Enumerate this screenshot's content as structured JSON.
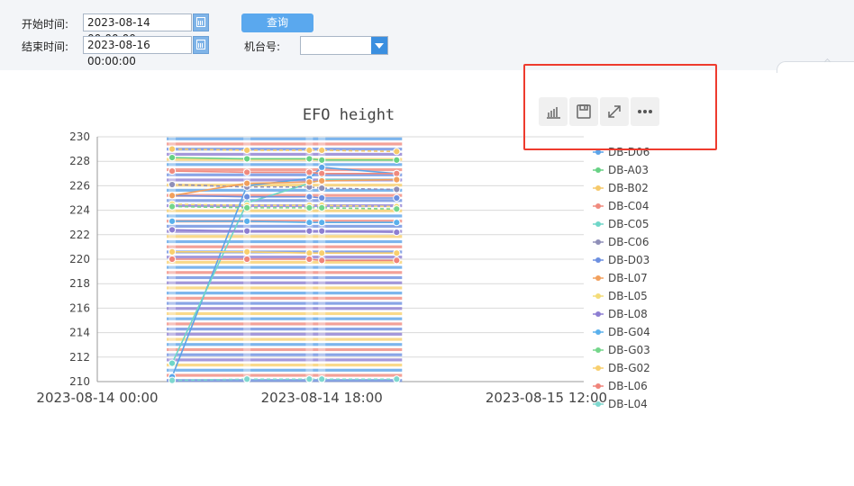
{
  "filters": {
    "start_label": "开始时间:",
    "start_value": "2023-08-14 00:00:00",
    "end_label": "结束时间:",
    "end_value": "2023-08-16 00:00:00",
    "machine_label": "机台号:",
    "machine_value": "",
    "query_button": "查询"
  },
  "toolbox": {
    "icons": [
      "bar-chart-icon",
      "save-icon",
      "expand-icon",
      "more-icon"
    ],
    "highlight_color": "#ee3b2e"
  },
  "chart_data": {
    "type": "line",
    "title": "EFO height",
    "xlabel": "",
    "ylabel": "",
    "x_ticks": [
      "2023-08-14 00:00",
      "2023-08-14 18:00",
      "2023-08-15 12:00"
    ],
    "y_ticks": [
      210,
      212,
      214,
      216,
      218,
      220,
      222,
      224,
      226,
      228,
      230
    ],
    "ylim": [
      210,
      230
    ],
    "xlim": [
      "2023-08-14 00:00",
      "2023-08-15 15:00"
    ],
    "grid": true,
    "legend_position": "right",
    "x": [
      "2023-08-14 06:00",
      "2023-08-14 12:00",
      "2023-08-14 17:00",
      "2023-08-14 18:00",
      "2023-08-15 00:00"
    ],
    "series": [
      {
        "name": "DB-D06",
        "color": "#5ba3e8",
        "values": [
          210.4,
          226.0,
          226.6,
          227.5,
          227.0
        ]
      },
      {
        "name": "DB-A03",
        "color": "#67d184",
        "values": [
          228.3,
          228.2,
          228.2,
          228.1,
          228.1
        ]
      },
      {
        "name": "DB-B02",
        "color": "#f6c96a",
        "values": [
          229.0,
          228.9,
          228.9,
          228.9,
          228.8
        ]
      },
      {
        "name": "DB-C04",
        "color": "#f08a7e",
        "values": [
          227.2,
          227.1,
          227.1,
          227.0,
          227.0
        ]
      },
      {
        "name": "DB-C05",
        "color": "#6fd6c8",
        "values": [
          211.5,
          224.6,
          226.2,
          226.5,
          226.5
        ]
      },
      {
        "name": "DB-C06",
        "color": "#8f8fb8",
        "values": [
          226.1,
          225.9,
          225.9,
          225.8,
          225.7
        ]
      },
      {
        "name": "DB-D03",
        "color": "#6c8fe0",
        "values": [
          225.2,
          225.1,
          225.1,
          225.0,
          225.0
        ]
      },
      {
        "name": "DB-L07",
        "color": "#f2a05d",
        "values": [
          225.2,
          226.2,
          226.3,
          226.4,
          226.5
        ]
      },
      {
        "name": "DB-L05",
        "color": "#f4dc78",
        "values": [
          224.5,
          224.4,
          224.4,
          224.4,
          224.3
        ]
      },
      {
        "name": "DB-L08",
        "color": "#8d7ed2",
        "values": [
          222.4,
          222.3,
          222.3,
          222.3,
          222.2
        ]
      },
      {
        "name": "DB-G04",
        "color": "#5ab0ec",
        "values": [
          223.1,
          223.1,
          223.0,
          223.0,
          223.0
        ]
      },
      {
        "name": "DB-G03",
        "color": "#74d68a",
        "values": [
          224.3,
          224.2,
          224.2,
          224.2,
          224.1
        ]
      },
      {
        "name": "DB-G02",
        "color": "#f8cf6e",
        "values": [
          220.6,
          220.6,
          220.5,
          220.5,
          220.5
        ]
      },
      {
        "name": "DB-L06",
        "color": "#f0847a",
        "values": [
          220.0,
          220.0,
          220.0,
          219.9,
          219.9
        ]
      },
      {
        "name": "DB-L04",
        "color": "#7ed8cf",
        "values": [
          210.1,
          210.2,
          210.2,
          210.2,
          210.2
        ]
      }
    ]
  }
}
